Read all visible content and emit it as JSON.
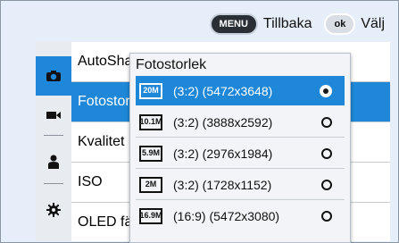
{
  "topbar": {
    "menu_key": "MENU",
    "back_label": "Tillbaka",
    "ok_key": "OK",
    "select_label": "Välj"
  },
  "tabs": [
    {
      "name": "camera-icon",
      "active": true
    },
    {
      "name": "video-icon",
      "active": false
    },
    {
      "name": "person-icon",
      "active": false
    },
    {
      "name": "gear-icon",
      "active": false
    }
  ],
  "menu": {
    "items": [
      {
        "label": "AutoSha"
      },
      {
        "label": "Fotostor"
      },
      {
        "label": "Kvalitet"
      },
      {
        "label": "ISO"
      },
      {
        "label": "OLED fär"
      }
    ],
    "selected_index": 1
  },
  "dropdown": {
    "title": "Fotostorlek",
    "options": [
      {
        "icon": "20M",
        "label": "(3:2) (5472x3648)",
        "selected": true
      },
      {
        "icon": "10.1M",
        "label": "(3:2) (3888x2592)",
        "selected": false
      },
      {
        "icon": "5.9M",
        "label": "(3:2) (2976x1984)",
        "selected": false
      },
      {
        "icon": "2M",
        "label": "(3:2) (1728x1152)",
        "selected": false
      },
      {
        "icon": "16.9M",
        "label": "(16:9) (5472x3080)",
        "selected": false
      }
    ]
  },
  "colors": {
    "accent": "#1f87d8",
    "background": "#e6eef9",
    "dark_panel": "#1c1f24"
  }
}
